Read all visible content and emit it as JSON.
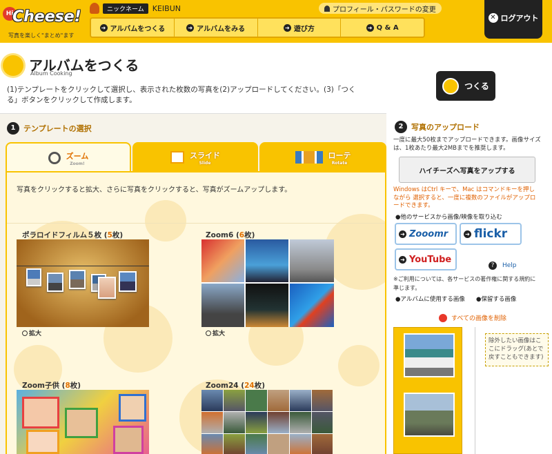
{
  "header": {
    "logo_hi": "Hi",
    "logo_name": "Cheese!",
    "logo_tagline": "写真を楽しく\"まとめ\"ます",
    "nickname_label": "ニックネーム",
    "username": "KEIBUN",
    "profile_link": "プロフィール・パスワードの変更",
    "logout_label": "ログアウト",
    "nav": [
      {
        "label": "アルバムをつくる"
      },
      {
        "label": "アルバムをみる"
      },
      {
        "label": "遊び方"
      },
      {
        "label": "Q & A"
      }
    ]
  },
  "page": {
    "title": "アルバムをつくる",
    "subtitle": "Album Cooking",
    "instructions": "(1)テンプレートをクリックして選択し、表示された枚数の写真を(2)アップロードしてください。(3)「つくる」ボタンをクリックして作成します。",
    "create_label": "つくる"
  },
  "template_section": {
    "step": "1",
    "heading": "テンプレートの選択",
    "tabs": [
      {
        "label": "ズーム",
        "sub": "Zoom!",
        "icon": "magnifier-icon"
      },
      {
        "label": "スライド",
        "sub": "Slide",
        "icon": "slide-icon"
      },
      {
        "label": "ローテ",
        "sub": "Rotate",
        "icon": "rotate-icon"
      }
    ],
    "zoom_description": "写真をクリックすると拡大、さらに写真をクリックすると、写真がズームアップします。",
    "enlarge_label": "拡大",
    "templates": [
      {
        "name": "ポラロイドフィルム５枚",
        "count": "5",
        "unit": "枚"
      },
      {
        "name": "Zoom6",
        "count": "6",
        "unit": "枚"
      },
      {
        "name": "Zoom子供",
        "count": "8",
        "unit": "枚"
      },
      {
        "name": "Zoom24",
        "count": "24",
        "unit": "枚"
      }
    ]
  },
  "upload_section": {
    "step": "2",
    "heading": "写真のアップロード",
    "description": "一度に最大50枚までアップロードできます。画像サイズは、1枚あたり最大2MBまでを推奨します。",
    "hyper_upload_label": "ハイチーズへ写真をアップする",
    "multi_select_hint": "Windows はCtrl キーで、Mac はコマンドキーを押しながら 選択すると、一度に複数のファイルがアップロードできます。",
    "other_services_label": "●他のサービスから画像/映像を取り込む",
    "services": [
      {
        "label": "Zooomr",
        "color": "#1a5fa8"
      },
      {
        "label": "flickr",
        "color": "#1a5fa8"
      },
      {
        "label": "YouTube",
        "color": "#d02020"
      }
    ],
    "help_label": "Help",
    "copyright_note": "※ご利用については、各サービスの著作権に関する規約に準じます。",
    "use_images_label": "●アルバムに使用する画像",
    "keep_images_label": "●保留する画像",
    "delete_all_label": "すべての画像を削除",
    "keep_drop_hint": "除外したい画像はここにドラッグ(あとで戻すこともできます)"
  },
  "colors": {
    "brand_yellow": "#f9c300",
    "accent_orange": "#e07000",
    "dark": "#222222"
  }
}
